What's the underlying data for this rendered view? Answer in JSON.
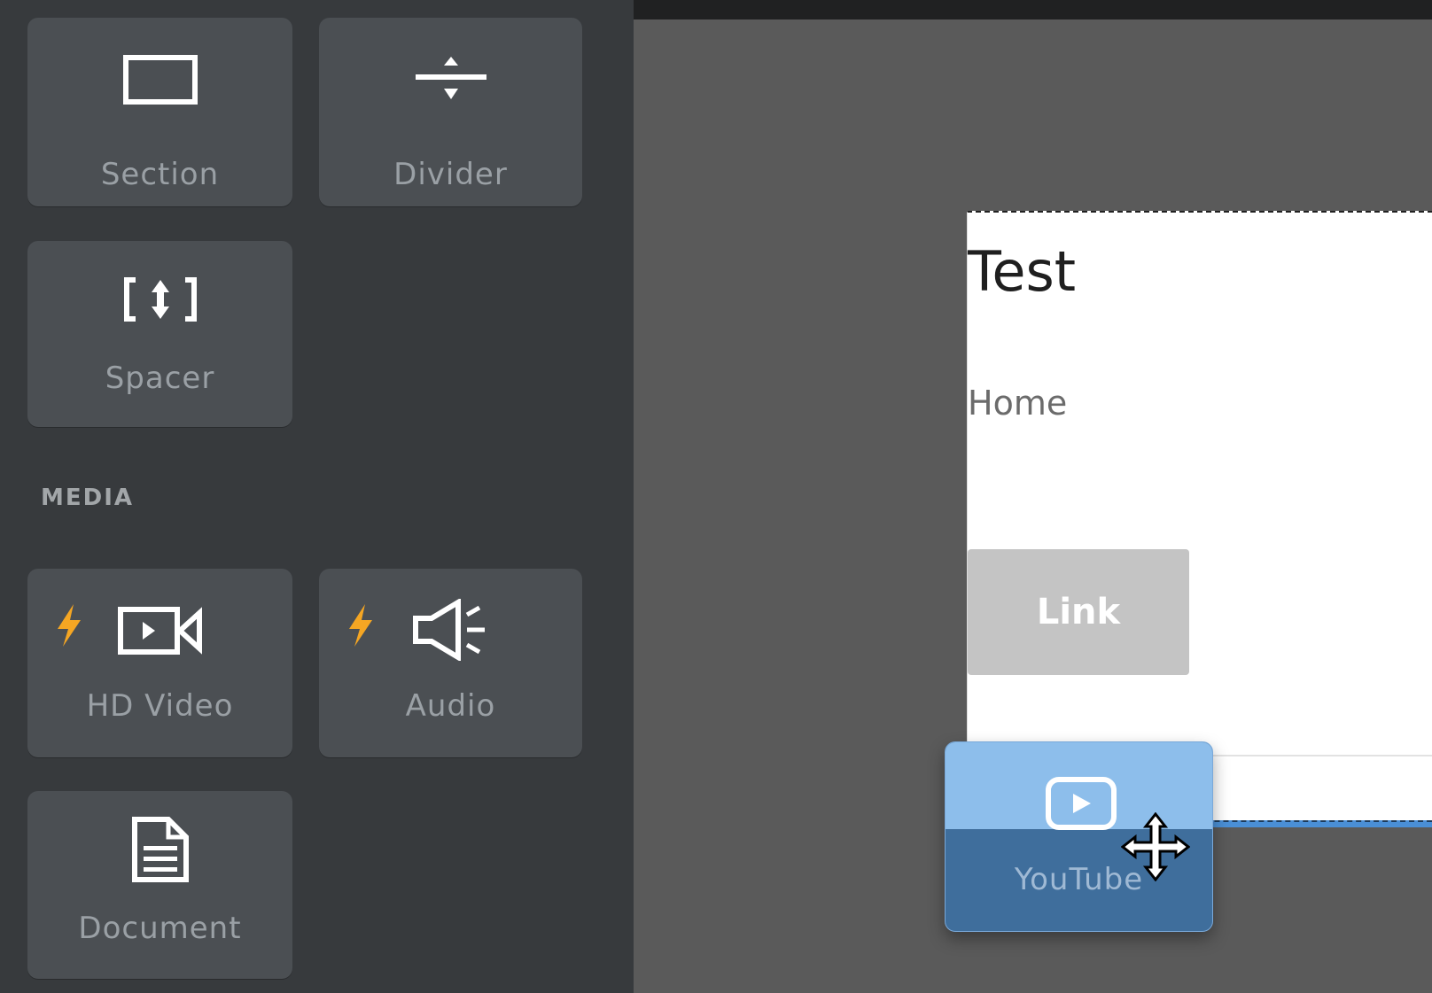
{
  "sidebar": {
    "tiles": {
      "section": "Section",
      "divider": "Divider",
      "spacer": "Spacer",
      "hd_video": "HD Video",
      "audio": "Audio",
      "document": "Document"
    },
    "media_heading": "MEDIA"
  },
  "canvas": {
    "title": "Test",
    "nav_link": "Home",
    "button_label": "Link"
  },
  "drag": {
    "label": "YouTube"
  },
  "colors": {
    "sidebar_bg": "#373a3d",
    "tile_bg": "#4b4f53",
    "accent_bolt": "#f5a623",
    "drag_blue": "#3f6e9c",
    "canvas_bg": "#5a5a5a"
  }
}
